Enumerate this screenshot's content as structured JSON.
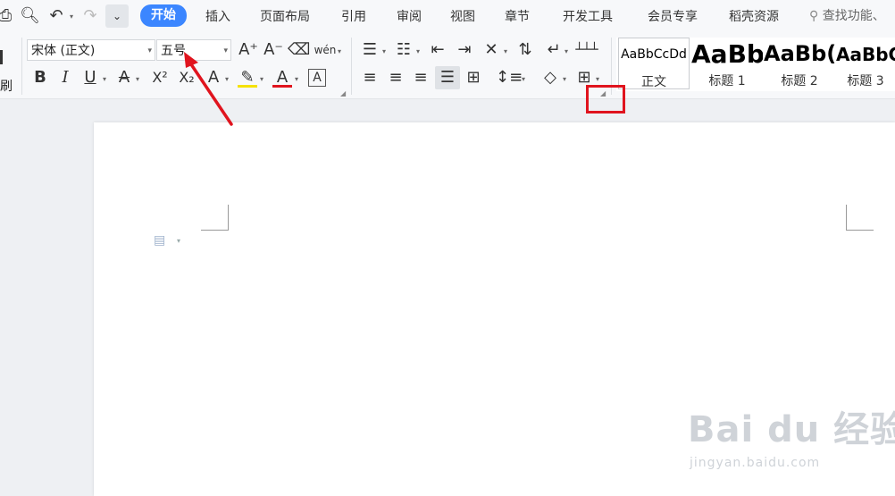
{
  "tabs": [
    {
      "label": "开始",
      "active": true
    },
    {
      "label": "插入"
    },
    {
      "label": "页面布局"
    },
    {
      "label": "引用"
    },
    {
      "label": "审阅"
    },
    {
      "label": "视图"
    },
    {
      "label": "章节"
    },
    {
      "label": "开发工具"
    },
    {
      "label": "会员专享"
    },
    {
      "label": "稻壳资源"
    }
  ],
  "search": {
    "label": "查找功能、"
  },
  "font": {
    "family": "宋体 (正文)",
    "size": "五号"
  },
  "clipboard": {
    "format_painter_label": "刷"
  },
  "styles": [
    {
      "preview": "AaBbCcDd",
      "label": "正文"
    },
    {
      "preview": "AaBb",
      "label": "标题 1"
    },
    {
      "preview": "AaBb(",
      "label": "标题 2"
    },
    {
      "preview": "AaBbC",
      "label": "标题 3"
    }
  ],
  "toolbar": {
    "bold": "B",
    "italic": "I",
    "underline": "U",
    "strike": "A",
    "superscript": "X²",
    "subscript": "X₂",
    "text_effect": "A",
    "font_color": "A",
    "char_border": "A",
    "phonetic": "wén",
    "grow": "A⁺",
    "shrink": "A⁻"
  },
  "colors": {
    "accent": "#3b86ff",
    "highlight_yellow": "#f5e200",
    "font_color_red": "#e0141e",
    "annotation_red": "#e0141e"
  },
  "watermark": {
    "logo": "Bai du 经验",
    "url": "jingyan.baidu.com"
  }
}
